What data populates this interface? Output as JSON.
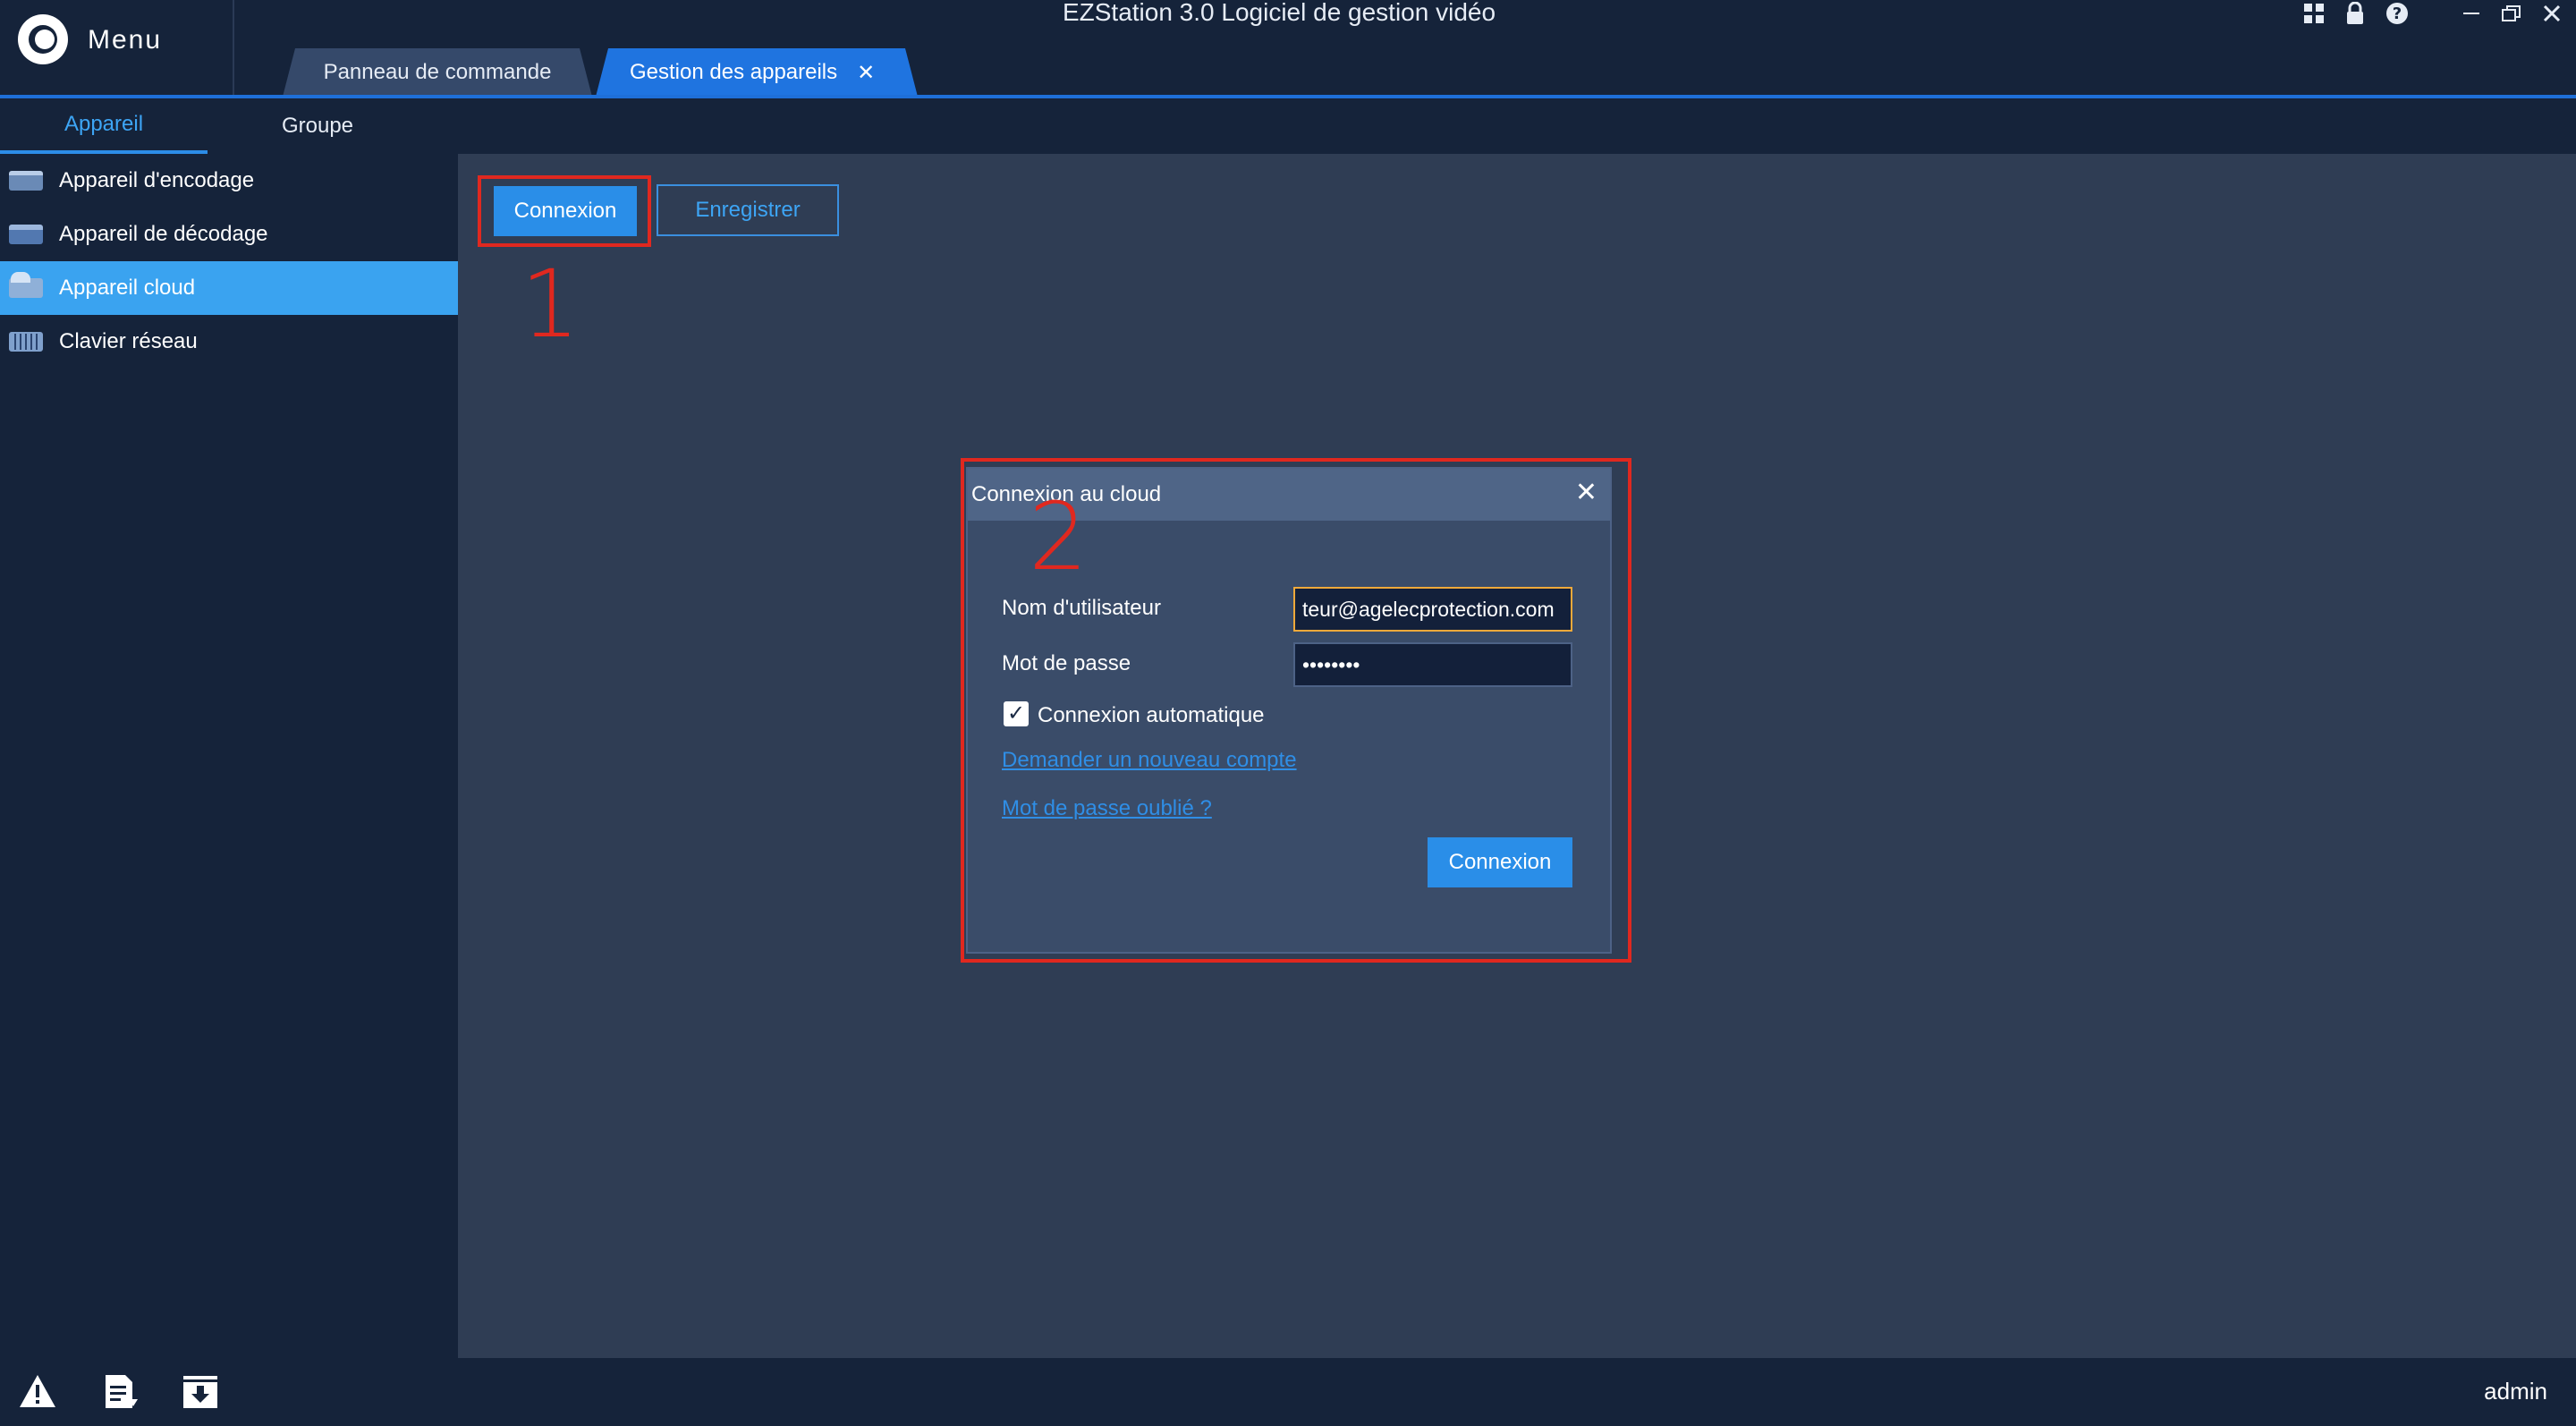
{
  "window": {
    "title": "EZStation 3.0 Logiciel de gestion vidéo",
    "menu_label": "Menu",
    "icons": [
      "layout-icon",
      "lock-icon",
      "help-icon",
      "minimize-icon",
      "restore-icon",
      "close-icon"
    ]
  },
  "tabs": [
    {
      "label": "Panneau de commande"
    },
    {
      "label": "Gestion des appareils",
      "close": "✕"
    }
  ],
  "subtabs": [
    {
      "label": "Appareil",
      "active": true
    },
    {
      "label": "Groupe"
    }
  ],
  "sidebar": {
    "items": [
      {
        "label": "Appareil d'encodage",
        "icon": "encoder-icon"
      },
      {
        "label": "Appareil de décodage",
        "icon": "decoder-icon"
      },
      {
        "label": "Appareil cloud",
        "icon": "cloud-device-icon",
        "active": true
      },
      {
        "label": "Clavier réseau",
        "icon": "keyboard-icon"
      }
    ]
  },
  "toolbar": {
    "login_label": "Connexion",
    "register_label": "Enregistrer"
  },
  "annotations": {
    "step1": "1",
    "step2": "2",
    "highlight_color": "#e0281f"
  },
  "dialog": {
    "title": "Connexion au cloud",
    "close": "✕",
    "username_label": "Nom d'utilisateur",
    "username_value": "teur@agelecprotection.com",
    "password_label": "Mot de passe",
    "password_value": "••••••••",
    "auto_login_label": "Connexion automatique",
    "auto_login_checked": true,
    "new_account_link": "Demander un nouveau compte",
    "forgot_password_link": "Mot de passe oublié ?",
    "submit_label": "Connexion"
  },
  "statusbar": {
    "icons": [
      "alarm-icon",
      "log-icon",
      "download-icon"
    ],
    "user": "admin"
  },
  "colors": {
    "accent": "#2a8ee8",
    "sidebar_active": "#3aa3f0",
    "background": "#2f3d54",
    "chrome": "#15233a"
  }
}
